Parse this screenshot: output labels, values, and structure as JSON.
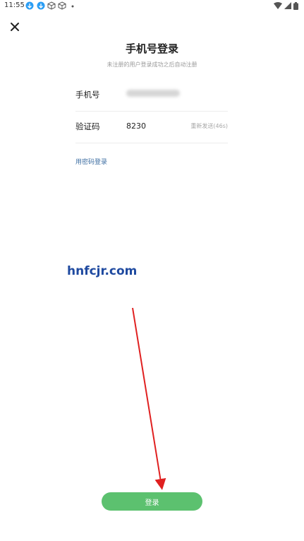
{
  "status_bar": {
    "time": "11:55"
  },
  "header": {
    "title": "手机号登录",
    "subtitle": "未注册的用户登录成功之后自动注册"
  },
  "form": {
    "phone": {
      "label": "手机号"
    },
    "code": {
      "label": "验证码",
      "value": "8230",
      "resend_label": "重新发送(46s)"
    }
  },
  "links": {
    "password_login": "用密码登录"
  },
  "watermark": {
    "text": "hnfcjr.com"
  },
  "actions": {
    "login_label": "登录"
  },
  "colors": {
    "accent_green": "#5cc16f",
    "link_blue": "#3f6fa3",
    "arrow_red": "#e02020"
  }
}
